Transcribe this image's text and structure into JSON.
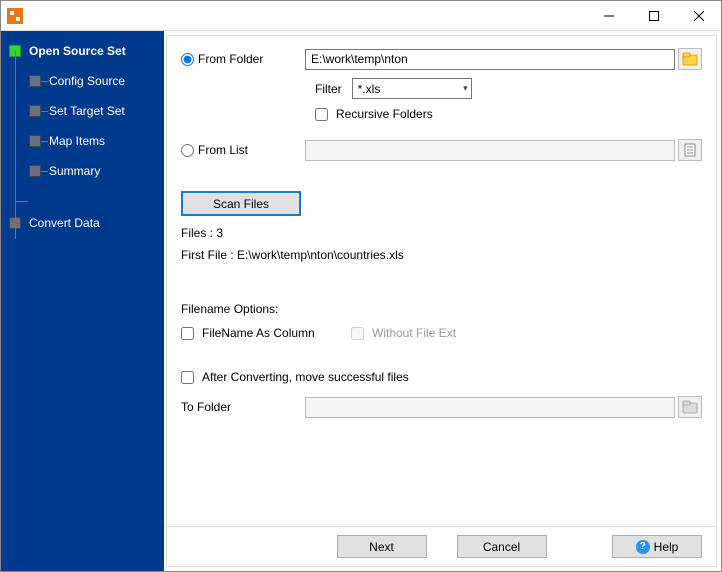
{
  "title": "",
  "sidebar": {
    "items": [
      {
        "label": "Open Source Set",
        "active": true
      },
      {
        "label": "Config Source",
        "active": false
      },
      {
        "label": "Set Target Set",
        "active": false
      },
      {
        "label": "Map Items",
        "active": false
      },
      {
        "label": "Summary",
        "active": false
      },
      {
        "label": "Convert Data",
        "active": false
      }
    ]
  },
  "source": {
    "from_folder_label": "From Folder",
    "folder_path": "E:\\work\\temp\\nton",
    "filter_label": "Filter",
    "filter_value": "*.xls",
    "recursive_label": "Recursive Folders",
    "from_list_label": "From List"
  },
  "scan": {
    "button_label": "Scan Files",
    "files_count_label": "Files : 3",
    "first_file_label": "First File : E:\\work\\temp\\nton\\countries.xls"
  },
  "filename_options": {
    "section_label": "Filename Options:",
    "as_column_label": "FileName As Column",
    "without_ext_label": "Without File Ext"
  },
  "after": {
    "move_label": "After Converting, move successful files",
    "to_folder_label": "To Folder"
  },
  "footer": {
    "next_label": "Next",
    "cancel_label": "Cancel",
    "help_label": "Help"
  }
}
